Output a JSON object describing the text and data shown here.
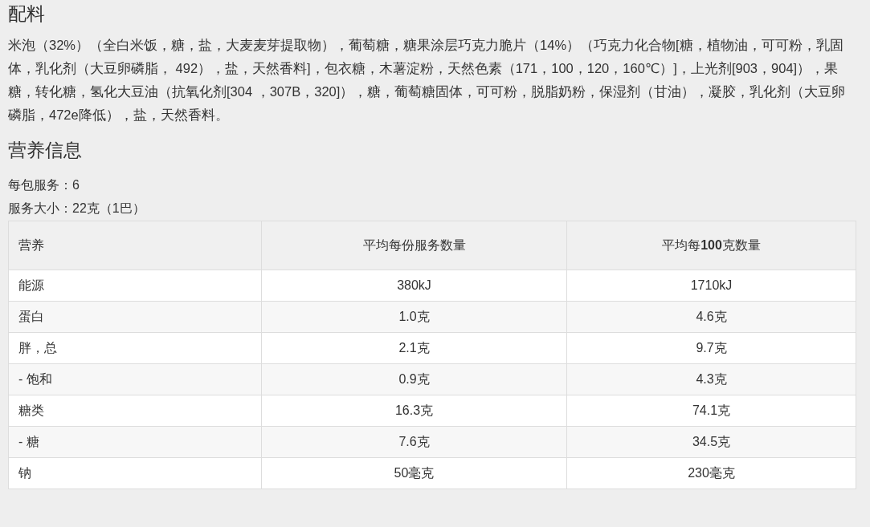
{
  "ingredients": {
    "heading": "配料",
    "text": "米泡（32%）（全白米饭，糖，盐，大麦麦芽提取物），葡萄糖，糖果涂层巧克力脆片（14%）（巧克力化合物[糖，植物油，可可粉，乳固体，乳化剂（大豆卵磷脂， 492），盐，天然香料]，包衣糖，木薯淀粉，天然色素（171，100，120，160℃）]，上光剂[903，904]），果糖，转化糖，氢化大豆油（抗氧化剂[304 ，307B，320]），糖，葡萄糖固体，可可粉，脱脂奶粉，保湿剂（甘油），凝胶，乳化剂（大豆卵磷脂，472e降低），盐，天然香料。"
  },
  "nutrition": {
    "heading": "营养信息",
    "servings_per_pack": "每包服务：6",
    "serving_size": "服务大小：22克（1巴）",
    "table": {
      "columns": [
        "营养",
        "平均每份服务数量",
        "平均每**100**克数量"
      ],
      "rows": [
        [
          "能源",
          "380kJ",
          "1710kJ"
        ],
        [
          "蛋白",
          "1.0克",
          "4.6克"
        ],
        [
          "胖，总",
          "2.1克",
          "9.7克"
        ],
        [
          "- 饱和",
          "0.9克",
          "4.3克"
        ],
        [
          "糖类",
          "16.3克",
          "74.1克"
        ],
        [
          "- 糖",
          "7.6克",
          "34.5克"
        ],
        [
          "钠",
          "50毫克",
          "230毫克"
        ]
      ]
    }
  }
}
